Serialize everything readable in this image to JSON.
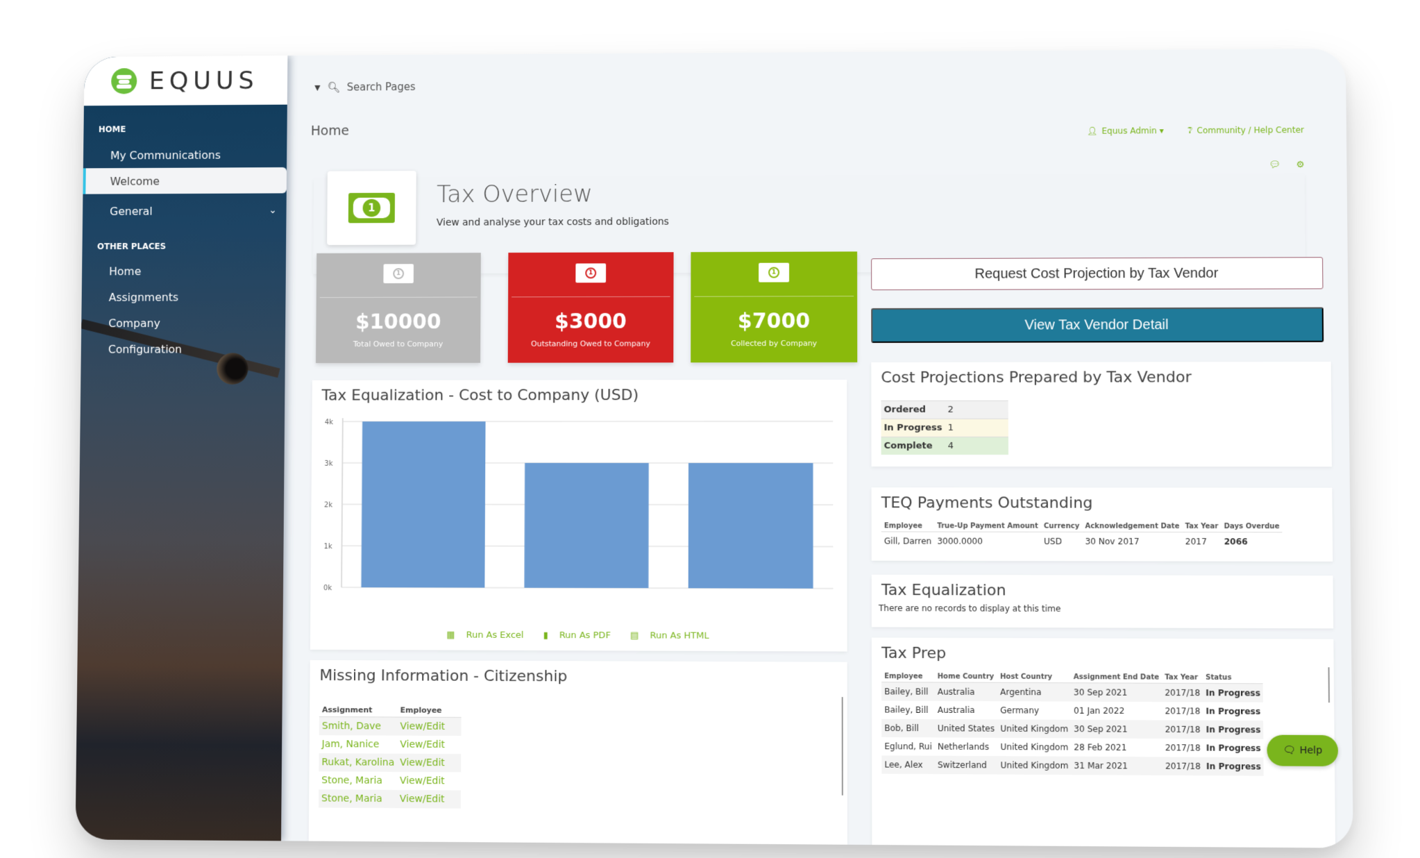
{
  "brand": {
    "name": "EQUUS",
    "accent": "#7ab51d",
    "logo_color": "#6cbf3c"
  },
  "sidebar": {
    "sections": [
      {
        "title": "HOME",
        "items": [
          {
            "label": "My Communications",
            "active": false
          },
          {
            "label": "Welcome",
            "active": true
          },
          {
            "label": "General",
            "active": false,
            "expandable": true
          }
        ]
      },
      {
        "title": "OTHER PLACES",
        "items": [
          {
            "label": "Home"
          },
          {
            "label": "Assignments"
          },
          {
            "label": "Company"
          },
          {
            "label": "Configuration"
          }
        ]
      }
    ]
  },
  "topbar": {
    "search_label": "Search Pages",
    "breadcrumb": "Home",
    "user_menu": "Equus Admin",
    "help_center": "Community / Help Center"
  },
  "header": {
    "title": "Tax Overview",
    "subtitle": "View and analyse your tax costs and obligations"
  },
  "kpis": [
    {
      "amount": "$10000",
      "label": "Total Owed to Company",
      "color": "#b9b9b9"
    },
    {
      "amount": "$3000",
      "label": "Outstanding Owed to Company",
      "color": "#d42222"
    },
    {
      "amount": "$7000",
      "label": "Collected by Company",
      "color": "#8aba0c"
    }
  ],
  "actions": {
    "request_projection": "Request Cost Projection by Tax Vendor",
    "view_vendor": "View Tax Vendor Detail"
  },
  "chart_data": {
    "type": "bar",
    "title": "Tax Equalization - Cost to Company (USD)",
    "categories": [
      "",
      "",
      ""
    ],
    "values": [
      4000,
      3000,
      3000
    ],
    "xlabel": "",
    "ylabel": "",
    "ylim": [
      0,
      4000
    ],
    "yticks": [
      "0k",
      "1k",
      "2k",
      "3k",
      "4k"
    ],
    "grid": true,
    "bar_color": "#6b9bd2"
  },
  "run_links": {
    "excel": "Run As Excel",
    "pdf": "Run As PDF",
    "html": "Run As HTML"
  },
  "cost_projections": {
    "title": "Cost Projections Prepared by Tax Vendor",
    "rows": [
      {
        "label": "Ordered",
        "count": "2",
        "bg": "#f1f1f1"
      },
      {
        "label": "In Progress",
        "count": "1",
        "bg": "#fcf8e3"
      },
      {
        "label": "Complete",
        "count": "4",
        "bg": "#dff0d8"
      }
    ]
  },
  "teq_payments": {
    "title": "TEQ Payments Outstanding",
    "headers": [
      "Employee",
      "True-Up Payment Amount",
      "Currency",
      "Acknowledgement Date",
      "Tax Year",
      "Days Overdue"
    ],
    "rows": [
      {
        "employee": "Gill, Darren",
        "amount": "3000.0000",
        "currency": "USD",
        "ack_date": "30 Nov 2017",
        "tax_year": "2017",
        "days_overdue": "2066"
      }
    ]
  },
  "tax_equalization": {
    "title": "Tax Equalization",
    "empty_message": "There are no records to display at this time"
  },
  "tax_prep": {
    "title": "Tax Prep",
    "headers": [
      "Employee",
      "Home Country",
      "Host Country",
      "Assignment End Date",
      "Tax Year",
      "Status"
    ],
    "rows": [
      {
        "employee": "Bailey, Bill",
        "home": "Australia",
        "host": "Argentina",
        "end": "30 Sep 2021",
        "year": "2017/18",
        "status": "In Progress"
      },
      {
        "employee": "Bailey, Bill",
        "home": "Australia",
        "host": "Germany",
        "end": "01 Jan 2022",
        "year": "2017/18",
        "status": "In Progress"
      },
      {
        "employee": "Bob, Bill",
        "home": "United States",
        "host": "United Kingdom",
        "end": "30 Sep 2021",
        "year": "2017/18",
        "status": "In Progress"
      },
      {
        "employee": "Eglund, Rui",
        "home": "Netherlands",
        "host": "United Kingdom",
        "end": "28 Feb 2021",
        "year": "2017/18",
        "status": "In Progress"
      },
      {
        "employee": "Lee, Alex",
        "home": "Switzerland",
        "host": "United Kingdom",
        "end": "31 Mar 2021",
        "year": "2017/18",
        "status": "In Progress"
      }
    ]
  },
  "missing_info": {
    "title": "Missing Information - Citizenship",
    "headers": [
      "Assignment",
      "Employee"
    ],
    "rows": [
      {
        "assignment": "Smith, Dave",
        "employee": "View/Edit"
      },
      {
        "assignment": "Jam, Nanice",
        "employee": "View/Edit"
      },
      {
        "assignment": "Rukat, Karolina",
        "employee": "View/Edit"
      },
      {
        "assignment": "Stone, Maria",
        "employee": "View/Edit"
      },
      {
        "assignment": "Stone, Maria",
        "employee": "View/Edit"
      }
    ]
  },
  "help_button": "Help"
}
